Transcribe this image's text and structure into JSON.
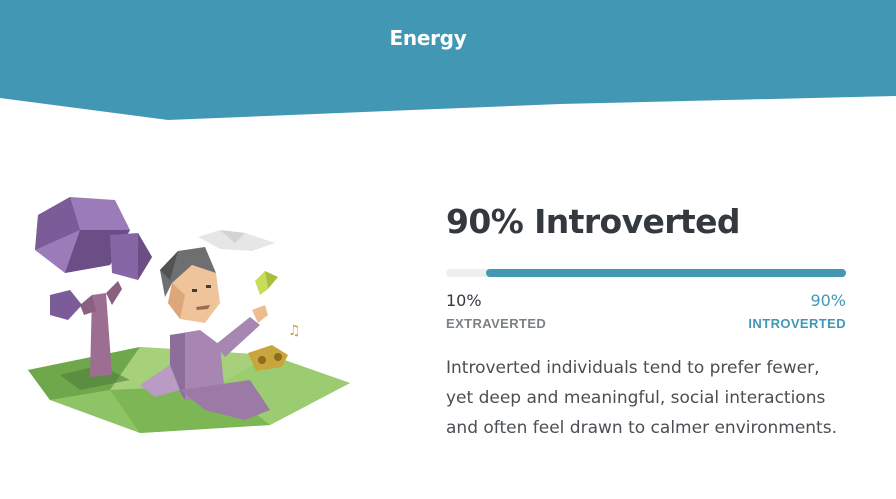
{
  "header": {
    "title": "Energy",
    "bg_color": "#4298b4"
  },
  "result": {
    "headline": "90% Introverted",
    "value": 0.9,
    "left": {
      "percent": "10%",
      "label": "EXTRAVERTED"
    },
    "right": {
      "percent": "90%",
      "label": "INTROVERTED"
    },
    "accent_color": "#4298b4"
  },
  "description": "Introverted individuals tend to prefer fewer, yet deep and meaningful, social interactions and often feel drawn to calmer environments.",
  "illustration": {
    "icon": "introvert-person-under-tree-illustration"
  }
}
